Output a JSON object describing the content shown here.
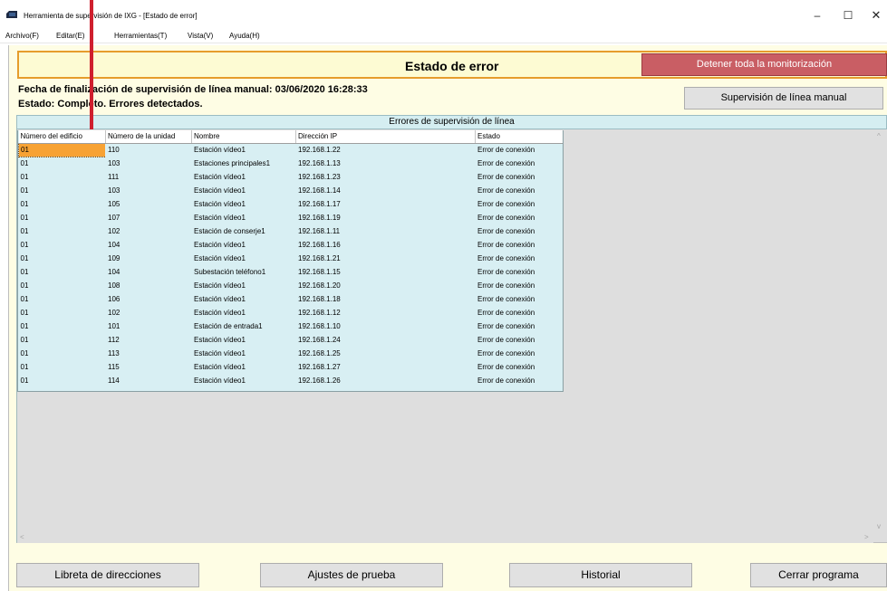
{
  "window": {
    "title": "Herramienta de supervisión de IXG - [Estado de error]",
    "minimize": "–",
    "maximize": "☐",
    "close": "✕",
    "icon": "app-icon"
  },
  "menu": [
    "Archivo(F)",
    "Editar(E)",
    "Herramientas(T)",
    "Vista(V)",
    "Ayuda(H)"
  ],
  "header": {
    "title": "Estado de error",
    "stop_button": "Detener toda la monitorización"
  },
  "info": {
    "completion": "Fecha de finalización de supervisión de línea manual: 03/06/2020 16:28:33",
    "status": "Estado: Completo. Errores detectados.",
    "manual_button": "Supervisión de línea manual"
  },
  "errors_panel": {
    "title": "Errores de supervisión de línea",
    "columns": [
      "Número del edificio",
      "Número de la unidad",
      "Nombre",
      "Dirección IP",
      "Estado"
    ],
    "rows": [
      [
        "01",
        "110",
        "Estación vídeo1",
        "192.168.1.22",
        "Error de conexión"
      ],
      [
        "01",
        "103",
        "Estaciones principales1",
        "192.168.1.13",
        "Error de conexión"
      ],
      [
        "01",
        "111",
        "Estación vídeo1",
        "192.168.1.23",
        "Error de conexión"
      ],
      [
        "01",
        "103",
        "Estación vídeo1",
        "192.168.1.14",
        "Error de conexión"
      ],
      [
        "01",
        "105",
        "Estación vídeo1",
        "192.168.1.17",
        "Error de conexión"
      ],
      [
        "01",
        "107",
        "Estación vídeo1",
        "192.168.1.19",
        "Error de conexión"
      ],
      [
        "01",
        "102",
        "Estación de conserje1",
        "192.168.1.11",
        "Error de conexión"
      ],
      [
        "01",
        "104",
        "Estación vídeo1",
        "192.168.1.16",
        "Error de conexión"
      ],
      [
        "01",
        "109",
        "Estación vídeo1",
        "192.168.1.21",
        "Error de conexión"
      ],
      [
        "01",
        "104",
        "Subestación teléfono1",
        "192.168.1.15",
        "Error de conexión"
      ],
      [
        "01",
        "108",
        "Estación vídeo1",
        "192.168.1.20",
        "Error de conexión"
      ],
      [
        "01",
        "106",
        "Estación vídeo1",
        "192.168.1.18",
        "Error de conexión"
      ],
      [
        "01",
        "102",
        "Estación vídeo1",
        "192.168.1.12",
        "Error de conexión"
      ],
      [
        "01",
        "101",
        "Estación de entrada1",
        "192.168.1.10",
        "Error de conexión"
      ],
      [
        "01",
        "112",
        "Estación vídeo1",
        "192.168.1.24",
        "Error de conexión"
      ],
      [
        "01",
        "113",
        "Estación vídeo1",
        "192.168.1.25",
        "Error de conexión"
      ],
      [
        "01",
        "115",
        "Estación vídeo1",
        "192.168.1.27",
        "Error de conexión"
      ],
      [
        "01",
        "114",
        "Estación vídeo1",
        "192.168.1.26",
        "Error de conexión"
      ]
    ]
  },
  "buttons": {
    "address_book": "Libreta de direcciones",
    "test_settings": "Ajustes de prueba",
    "history": "Historial",
    "close_program": "Cerrar programa"
  },
  "colors": {
    "header_border": "#e69c2c",
    "stop_button": "#c95e64",
    "selected_cell": "#f7a234",
    "row_background": "#d8eff3",
    "annotation_pointer": "#cf1f2e"
  }
}
